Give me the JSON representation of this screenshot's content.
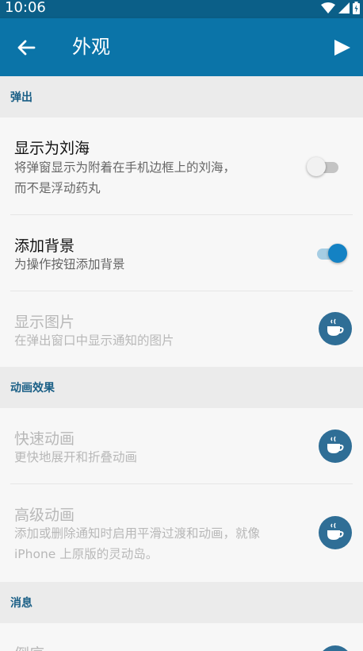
{
  "status_bar": {
    "time": "10:06"
  },
  "app_bar": {
    "title": "外观"
  },
  "sections": [
    {
      "header": "弹出"
    },
    {
      "header": "动画效果"
    },
    {
      "header": "消息"
    }
  ],
  "items": {
    "notch": {
      "title": "显示为刘海",
      "subtitle": "将弹窗显示为附着在手机边框上的刘海，\n而不是浮动药丸",
      "toggle": "off"
    },
    "background": {
      "title": "添加背景",
      "subtitle": "为操作按钮添加背景",
      "toggle": "on"
    },
    "images": {
      "title": "显示图片",
      "subtitle": "在弹出窗口中显示通知的图片",
      "locked": true
    },
    "fast_anim": {
      "title": "快速动画",
      "subtitle": "更快地展开和折叠动画",
      "locked": true
    },
    "advanced_anim": {
      "title": "高级动画",
      "subtitle": "添加或删除通知时启用平滑过渡和动画，就像\niPhone 上原版的灵动岛。",
      "locked": true
    },
    "partial": {
      "title": "倒序"
    }
  },
  "colors": {
    "accent": "#0b74a8",
    "status_bar": "#0b5f88",
    "section_text": "#1a5f86",
    "toggle_on": "#1482c4",
    "premium_badge": "#2f6e96"
  },
  "icons": {
    "back": "arrow-left-icon",
    "play": "play-icon",
    "premium": "coffee-cup-icon"
  }
}
